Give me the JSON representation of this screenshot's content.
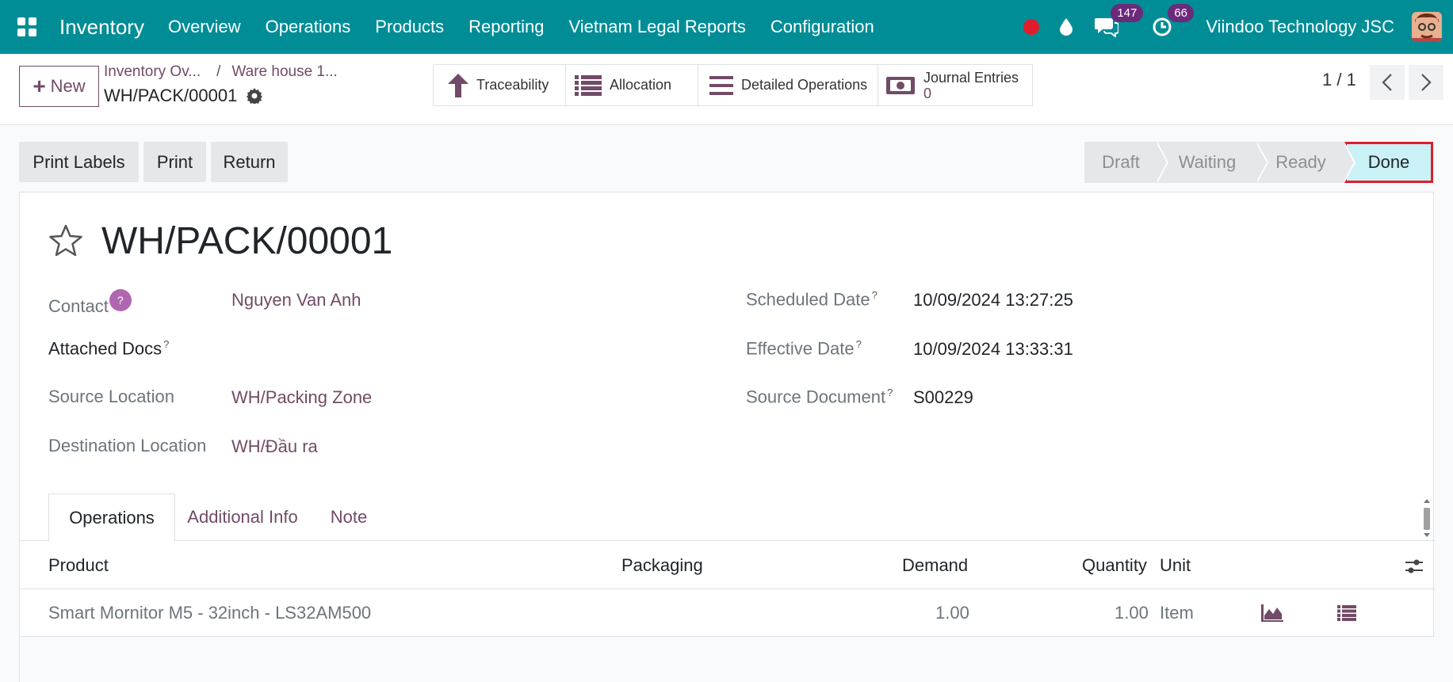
{
  "navbar": {
    "app_title": "Inventory",
    "menu": [
      "Overview",
      "Operations",
      "Products",
      "Reporting",
      "Vietnam Legal Reports",
      "Configuration"
    ],
    "messages_count": "147",
    "activities_count": "66",
    "company": "Viindoo Technology JSC",
    "bg_color": "#018d96"
  },
  "control": {
    "new_label": "New",
    "breadcrumb_1": "Inventory Ov...",
    "breadcrumb_2": "Ware house 1...",
    "breadcrumb_sep": "/",
    "current_record": "WH/PACK/00001",
    "smart_buttons": {
      "traceability": "Traceability",
      "allocation": "Allocation",
      "detailed_operations": "Detailed Operations",
      "journal_entries": "Journal Entries",
      "journal_entries_count": "0"
    },
    "pager": "1 / 1"
  },
  "actions": {
    "print_labels": "Print Labels",
    "print": "Print",
    "return": "Return"
  },
  "statusbar": {
    "stages": [
      "Draft",
      "Waiting",
      "Ready",
      "Done"
    ],
    "current": "Done"
  },
  "record": {
    "title": "WH/PACK/00001",
    "fields": {
      "contact_label": "Contact",
      "contact_help": "?",
      "contact_value": "Nguyen Van Anh",
      "attached_docs_label": "Attached Docs",
      "source_location_label": "Source Location",
      "source_location_value": "WH/Packing Zone",
      "destination_location_label": "Destination Location",
      "destination_location_value": "WH/Đầu ra",
      "scheduled_date_label": "Scheduled Date",
      "scheduled_date_value": "10/09/2024 13:27:25",
      "effective_date_label": "Effective Date",
      "effective_date_value": "10/09/2024 13:33:31",
      "source_document_label": "Source Document",
      "source_document_value": "S00229",
      "help_mark": "?"
    }
  },
  "tabs": [
    "Operations",
    "Additional Info",
    "Note"
  ],
  "operations_table": {
    "columns": [
      "Product",
      "Packaging",
      "Demand",
      "Quantity",
      "Unit"
    ],
    "rows": [
      {
        "product": "Smart Mornitor M5 - 32inch - LS32AM500",
        "packaging": "",
        "demand": "1.00",
        "quantity": "1.00",
        "unit": "Item"
      }
    ]
  }
}
